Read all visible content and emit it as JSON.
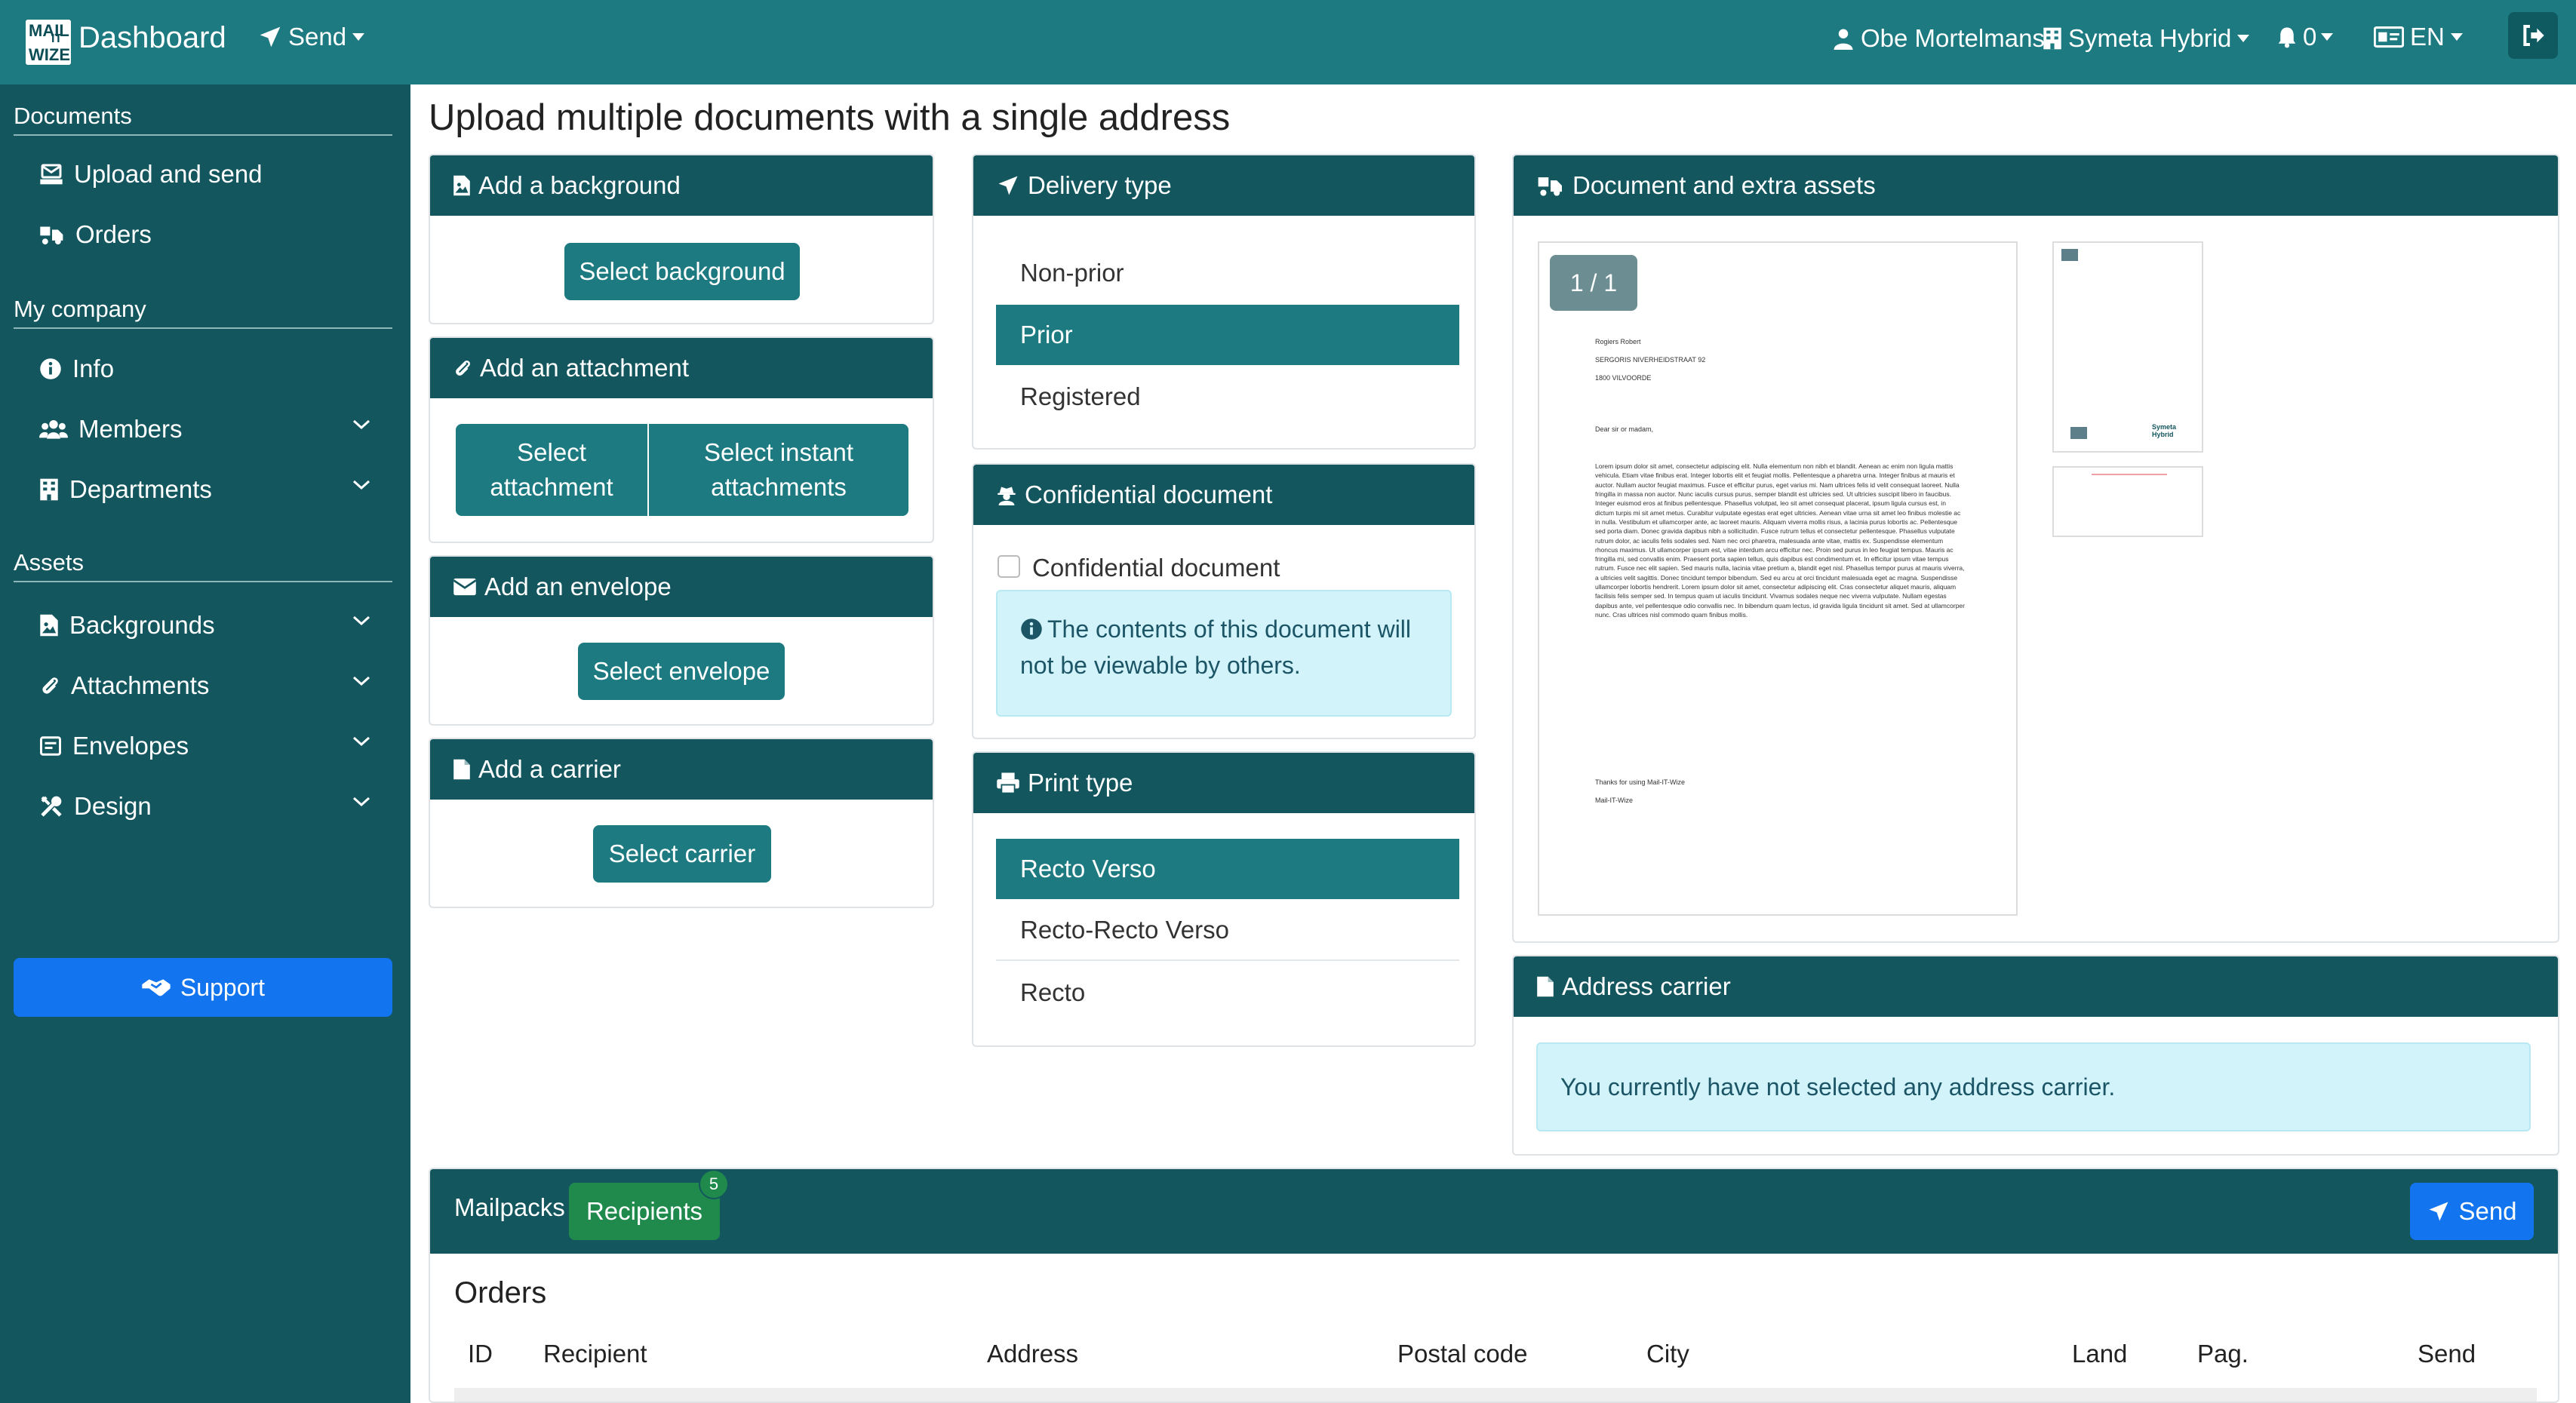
{
  "topbar": {
    "logo_lines": [
      "MAIL",
      "IT",
      "WIZE"
    ],
    "title": "Dashboard",
    "send_label": "Send",
    "user": "Obe Mortelmans",
    "company": "Symeta Hybrid",
    "notifications": "0",
    "language": "EN"
  },
  "sidebar": {
    "documents": {
      "heading": "Documents",
      "items": [
        {
          "label": "Upload and send"
        },
        {
          "label": "Orders"
        }
      ]
    },
    "company": {
      "heading": "My company",
      "items": [
        {
          "label": "Info"
        },
        {
          "label": "Members"
        },
        {
          "label": "Departments"
        }
      ]
    },
    "assets": {
      "heading": "Assets",
      "items": [
        {
          "label": "Backgrounds"
        },
        {
          "label": "Attachments"
        },
        {
          "label": "Envelopes"
        },
        {
          "label": "Design"
        }
      ]
    },
    "support_label": "Support"
  },
  "page_title": "Upload multiple documents with a single address",
  "background_card": {
    "title": "Add a background",
    "button": "Select background"
  },
  "attachment_card": {
    "title": "Add an attachment",
    "button_select": "Select attachment",
    "button_instant": "Select instant attachments"
  },
  "envelope_card": {
    "title": "Add an envelope",
    "button": "Select envelope"
  },
  "carrier_card": {
    "title": "Add a carrier",
    "button": "Select carrier"
  },
  "delivery_card": {
    "title": "Delivery type",
    "options": [
      "Non-prior",
      "Prior",
      "Registered"
    ],
    "selected": "Prior"
  },
  "confidential_card": {
    "title": "Confidential document",
    "checkbox_label": "Confidential document",
    "checked": false,
    "info": "The contents of this document will not be viewable by others."
  },
  "print_card": {
    "title": "Print type",
    "options": [
      "Recto Verso",
      "Recto-Recto Verso",
      "Recto"
    ],
    "selected": "Recto Verso"
  },
  "document_card": {
    "title": "Document and extra assets",
    "page_indicator": "1 / 1",
    "letter": {
      "name": "Rogiers Robert",
      "street": "SERGORIS NIVERHEIDSTRAAT 92",
      "city": "1800 VILVOORDE",
      "greeting": "Dear sir or madam,",
      "body": "Lorem ipsum dolor sit amet, consectetur adipiscing elit. Nulla elementum non nibh et blandit. Aenean ac enim non ligula mattis vehicula. Etiam vitae finibus erat. Integer lobortis elit et feugiat mollis. Pellentesque a pharetra urna. Integer finibus at mauris et auctor. Nullam auctor feugiat maximus. Fusce et efficitur purus, eget varius mi. Nam ultrices felis id velit consequat laoreet. Nulla fringilla in massa non auctor. Nunc iaculis cursus purus, semper blandit est ultricies sed. Ut ultricies suscipit libero in faucibus. Integer euismod eros at finibus pellentesque. Phasellus volutpat, leo sit amet consequat placerat, ipsum ligula cursus est, in dictum turpis mi sit amet metus. Curabitur vulputate egestas erat eget ultricies. Aenean vitae urna sit amet leo finibus molestie ac in nulla. Vestibulum et ullamcorper ante, ac laoreet mauris. Aliquam viverra mollis risus, a lacinia purus lobortis ac. Pellentesque sed porta diam. Donec gravida dapibus nibh a sollicitudin. Fusce rutrum tellus et consectetur pellentesque. Phasellus vulputate rutrum dolor, ac iaculis felis sodales sed. Nam nec orci pharetra, malesuada ante vitae, mattis ex. Suspendisse elementum rhoncus maximus. Ut ullamcorper ipsum est, vitae interdum arcu efficitur nec. Proin sed purus in leo feugiat tempus. Mauris ac fringilla mi, sed convallis enim. Praesent porta sapien tellus, quis dapibus est condimentum et. In efficitur ipsum vitae tempus rutrum. Fusce nec elit sapien. Sed mauris nulla, lacinia vitae pretium a, blandit eget nisl. Phasellus tempor purus at mauris viverra, a ultricies velit sagittis. Donec tincidunt tempor bibendum. Sed eu arcu at orci tincidunt malesuada eget ac magna. Suspendisse ullamcorper lobortis hendrerit. Lorem ipsum dolor sit amet, consectetur adipiscing elit. Cras consectetur aliquet mauris, aliquam facilisis felis semper sed. In tempus quam ut iaculis tincidunt. Vivamus sodales neque nec viverra vulputate. Nullam egestas dapibus ante, vel pellentesque odio convallis nec. In bibendum quam lectus, id gravida ligula tincidunt sit amet. Sed at ullamcorper nunc. Cras ultrices nisl commodo quam finibus mollis.",
      "thanks": "Thanks for using Mail-IT-Wize",
      "signature": "Mail-IT-Wize"
    },
    "thumb_logo": "Symeta Hybrid"
  },
  "address_carrier_card": {
    "title": "Address carrier",
    "info": "You currently have not selected any address carrier."
  },
  "mailpacks": {
    "label": "Mailpacks",
    "recipients_label": "Recipients",
    "recipients_count": "5",
    "send_label": "Send",
    "orders_title": "Orders",
    "columns": [
      "ID",
      "Recipient",
      "Address",
      "Postal code",
      "City",
      "Land",
      "Pag.",
      "Send"
    ]
  },
  "colors": {
    "header_teal": "#1c7a80",
    "sidebar_dark": "#13565e",
    "primary_blue": "#1274ee",
    "success_green": "#1f8a4c",
    "info_bg": "#d2f3fa"
  }
}
